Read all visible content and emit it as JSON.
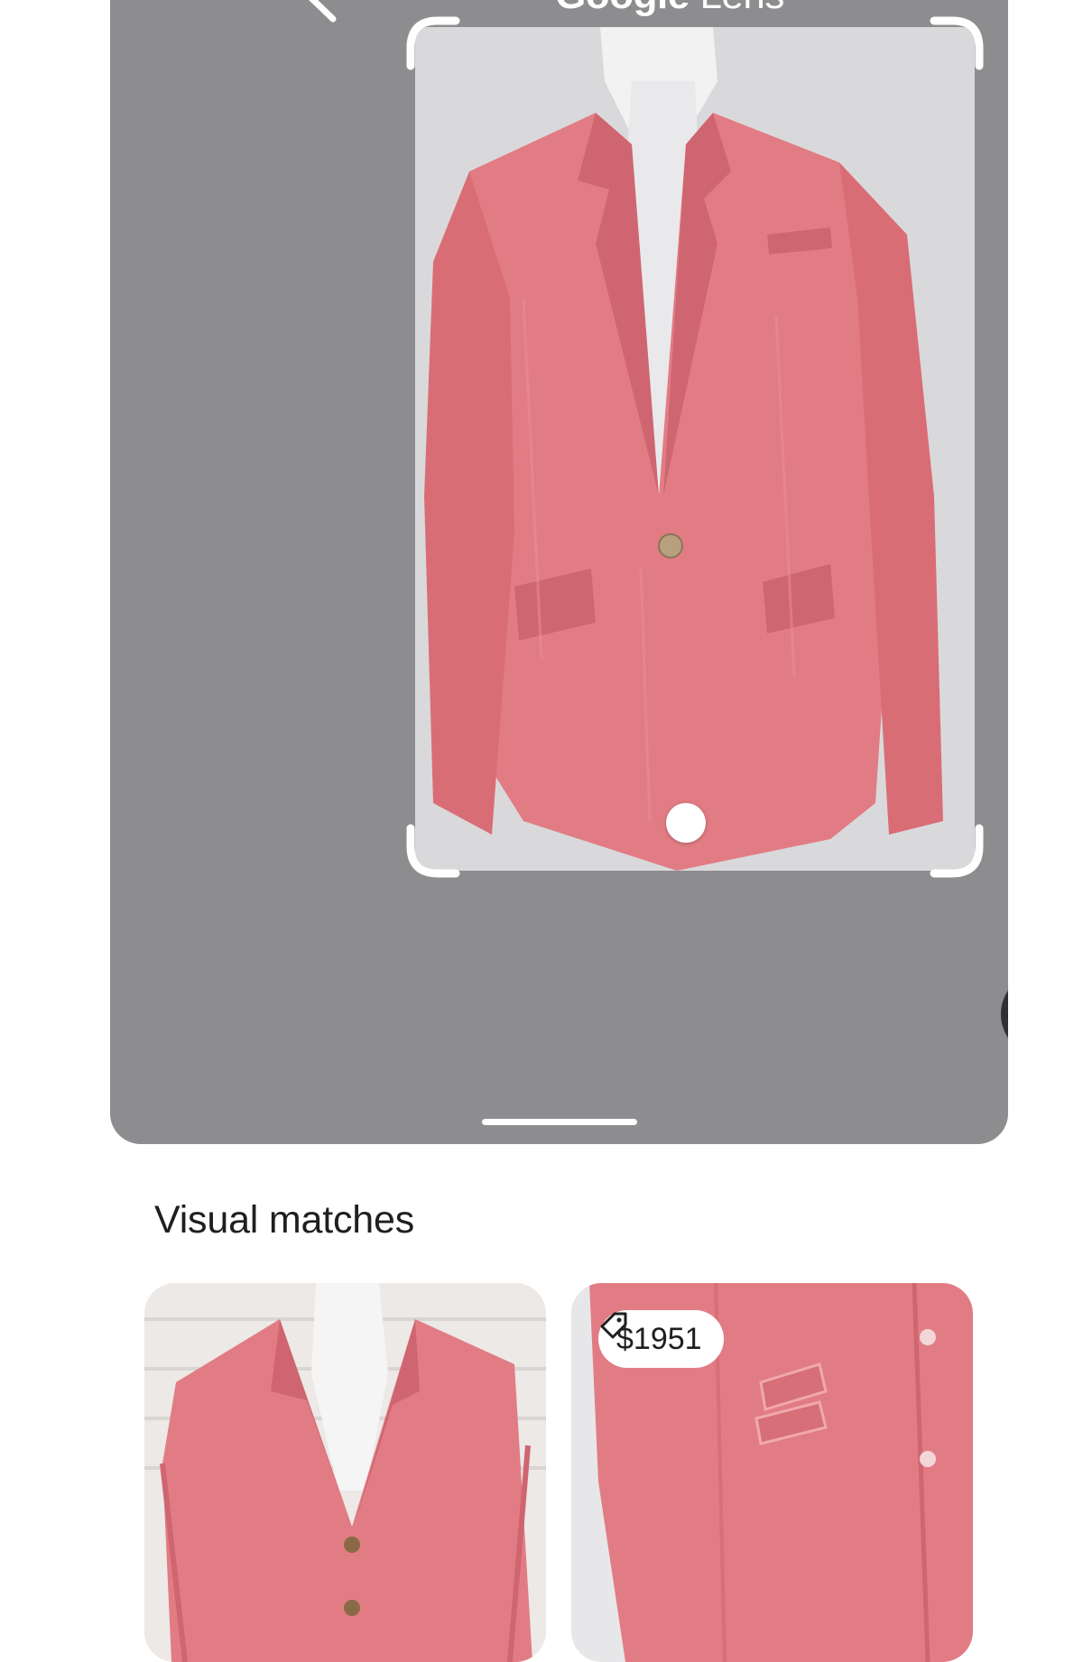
{
  "header": {
    "title_brand": "Google",
    "title_product": "Lens",
    "back_icon": "chevron-left-icon"
  },
  "viewer": {
    "background": "#8d8d8f",
    "search_icon": "image-search-icon"
  },
  "results": {
    "section_title": "Visual matches",
    "cards": [
      {
        "image": "pink linen blazer on mannequin"
      },
      {
        "image": "pink linen blazer pocket close-up",
        "price_icon": "price-tag-icon",
        "price": "$1951"
      }
    ]
  },
  "colors": {
    "blazer": "#e27c84",
    "accent_dark": "#2f3033"
  }
}
